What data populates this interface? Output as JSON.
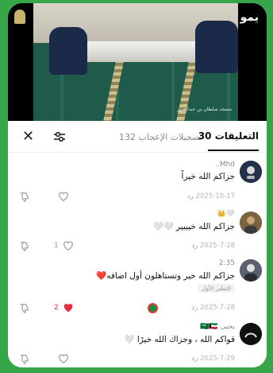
{
  "video": {
    "watermark": "يمو",
    "caption_right": "‫مسجد سلطان بن عبدالعزيز‬",
    "caption_right2": "",
    "caption_left": ""
  },
  "header": {
    "comments_label": "التعليقات",
    "comments_count": "30",
    "likes_label": "تسجيلات الإعجاب",
    "likes_count": "132"
  },
  "comments": [
    {
      "user": "Mhd..",
      "text": "جزاكم الله خيراً",
      "date": "2025-10-17",
      "reply": "رد",
      "likes": "",
      "liked": false
    },
    {
      "user": "🤍👑",
      "text": "جزاكم الله خيييير 🤍🤍",
      "date": "2025-7-28",
      "reply": "رد",
      "likes": "1",
      "liked": false
    },
    {
      "user": "2:35",
      "text": "جزاكم الله خير وتستاهلون أول اضافه❤️",
      "pinned": "التطير الأول",
      "date": "2025-7-28",
      "reply": "رد",
      "likes": "2",
      "liked": true
    },
    {
      "user": "يحيى 🇸🇦🇰🇼",
      "text": "قواكم الله ، وجزاك الله خيرًا 🤍",
      "date": "2025-7-29",
      "reply": "رد",
      "likes": "",
      "liked": false
    }
  ],
  "colors": {
    "frame": "#37a64a",
    "heart_liked": "#e8283e",
    "text_primary": "#111111",
    "text_secondary": "#8a8a8a"
  },
  "icons": {
    "close": "close-icon",
    "filter": "filter-icon",
    "heart": "heart-icon",
    "dislike": "dislike-icon"
  }
}
